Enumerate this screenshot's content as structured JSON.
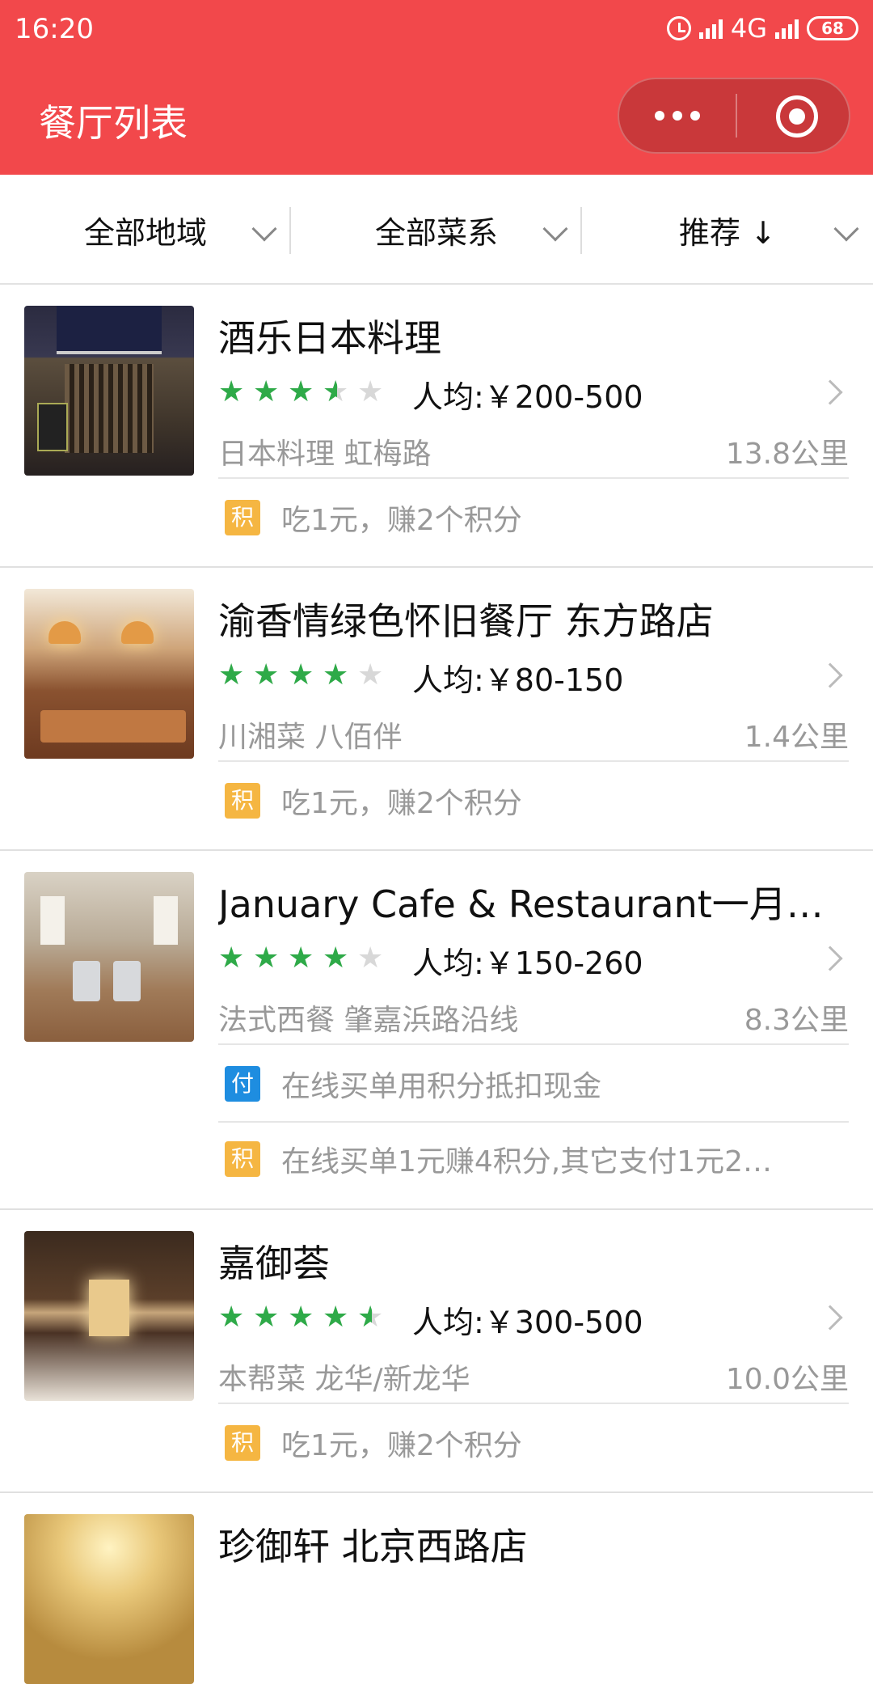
{
  "status_bar": {
    "time": "16:20",
    "network": "4G",
    "battery": "68"
  },
  "header": {
    "title": "餐厅列表"
  },
  "filters": [
    {
      "label": "全部地域"
    },
    {
      "label": "全部菜系"
    },
    {
      "label": "推荐 ↓"
    }
  ],
  "colors": {
    "header_bg": "#f2484b",
    "star_on": "#2eaa48",
    "badge_points": "#f5b642",
    "badge_pay": "#1e8de0"
  },
  "restaurants": [
    {
      "name": "酒乐日本料理",
      "rating": 3.5,
      "price": "人均:￥200-500",
      "tags": "日本料理 虹梅路",
      "distance": "13.8公里",
      "promos": [
        {
          "badge": "积",
          "type": "points",
          "text": "吃1元，赚2个积分"
        }
      ]
    },
    {
      "name": "渝香情绿色怀旧餐厅 东方路店",
      "rating": 4,
      "price": "人均:￥80-150",
      "tags": "川湘菜 八佰伴",
      "distance": "1.4公里",
      "promos": [
        {
          "badge": "积",
          "type": "points",
          "text": "吃1元，赚2个积分"
        }
      ]
    },
    {
      "name": "January Cafe & Restaurant一月…",
      "rating": 4,
      "price": "人均:￥150-260",
      "tags": "法式西餐 肇嘉浜路沿线",
      "distance": "8.3公里",
      "promos": [
        {
          "badge": "付",
          "type": "pay",
          "text": "在线买单用积分抵扣现金"
        },
        {
          "badge": "积",
          "type": "points",
          "text": "在线买单1元赚4积分,其它支付1元2…"
        }
      ]
    },
    {
      "name": "嘉御荟",
      "rating": 4.5,
      "price": "人均:￥300-500",
      "tags": "本帮菜 龙华/新龙华",
      "distance": "10.0公里",
      "promos": [
        {
          "badge": "积",
          "type": "points",
          "text": "吃1元，赚2个积分"
        }
      ]
    },
    {
      "name": "珍御轩 北京西路店"
    }
  ]
}
